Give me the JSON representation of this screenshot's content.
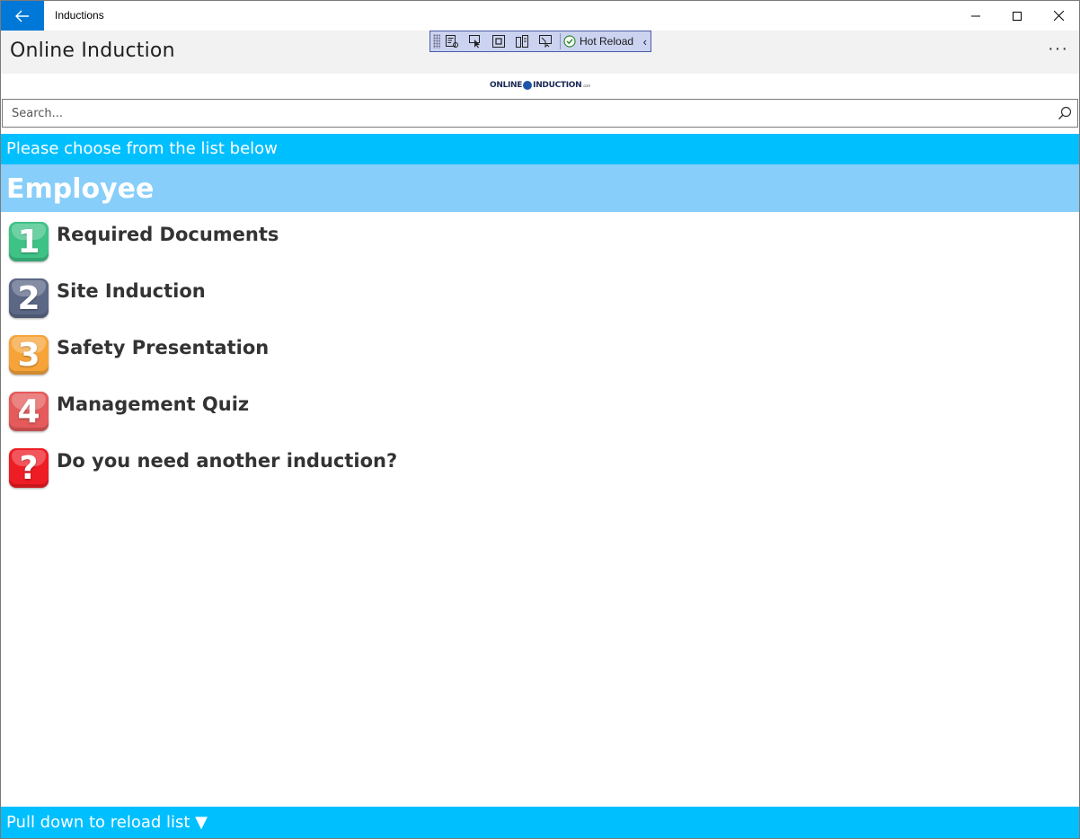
{
  "window": {
    "title": "Inductions",
    "accent": "#0078d7"
  },
  "app": {
    "title": "Online Induction",
    "more_label": "···"
  },
  "debug_toolbar": {
    "tools": [
      "select-element-icon",
      "pointer-icon",
      "layout-adorner-icon",
      "track-focus-icon",
      "display-layout-icon"
    ],
    "hot_reload_label": "Hot Reload",
    "collapse_label": "‹"
  },
  "logo": {
    "left": "ONLINE",
    "right": "INDUCTION",
    "suffix": ".com"
  },
  "search": {
    "placeholder": "Search..."
  },
  "banner": {
    "text": "Please choose from the list below",
    "color": "#00bfff"
  },
  "group": {
    "title": "Employee",
    "color": "#87cefa"
  },
  "items": [
    {
      "badge": "1",
      "label": "Required Documents",
      "color": "#3ec286"
    },
    {
      "badge": "2",
      "label": "Site Induction",
      "color": "#5b6785"
    },
    {
      "badge": "3",
      "label": "Safety Presentation",
      "color": "#f6a43a"
    },
    {
      "badge": "4",
      "label": "Management Quiz",
      "color": "#e55a5a"
    },
    {
      "badge": "?",
      "label": "Do you need another induction?",
      "color": "#ee1c24"
    }
  ],
  "footer": {
    "text": "Pull down to reload list ▼"
  }
}
